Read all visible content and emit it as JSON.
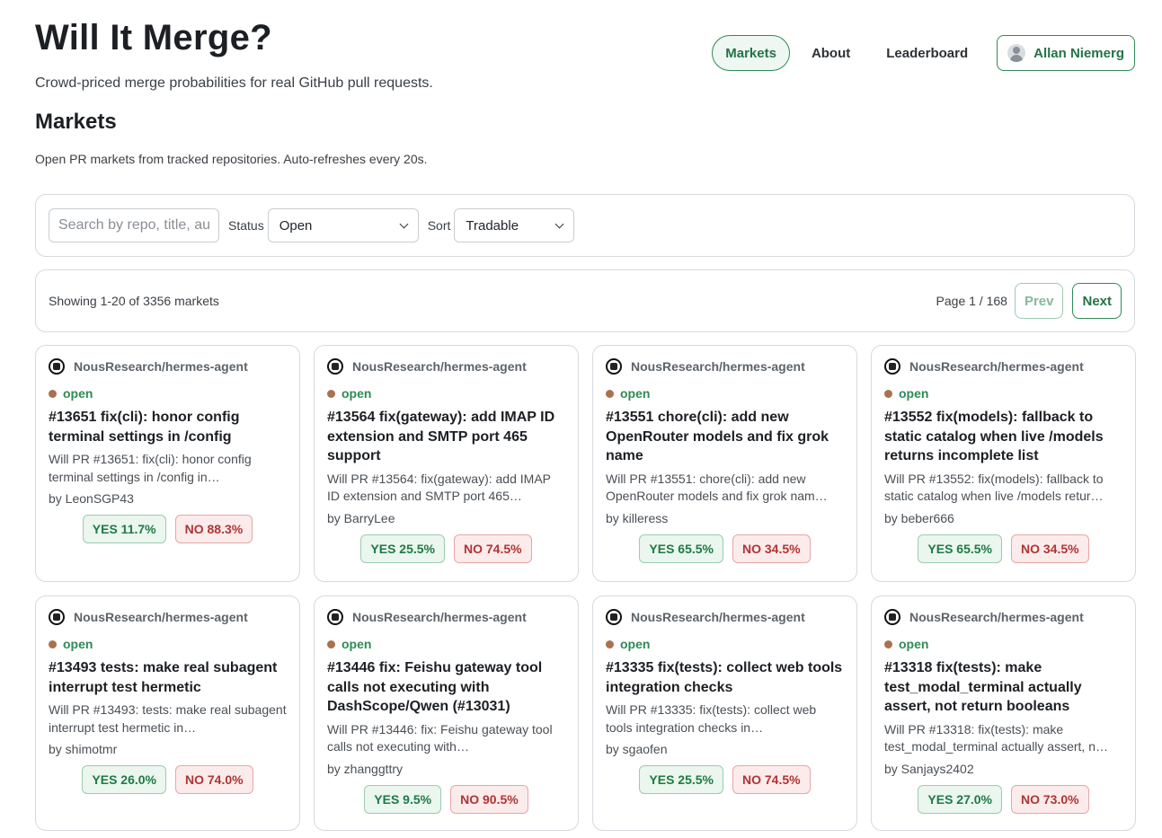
{
  "site": {
    "title": "Will It Merge?",
    "tagline": "Crowd-priced merge probabilities for real GitHub pull requests."
  },
  "nav": {
    "markets": "Markets",
    "about": "About",
    "leaderboard": "Leaderboard",
    "user": "Allan Niemerg"
  },
  "section": {
    "title": "Markets",
    "subtitle": "Open PR markets from tracked repositories. Auto-refreshes every 20s."
  },
  "filters": {
    "search_placeholder": "Search by repo, title, author",
    "status_label": "Status",
    "status_value": "Open",
    "sort_label": "Sort",
    "sort_value": "Tradable"
  },
  "pagination": {
    "showing": "Showing 1-20 of 3356 markets",
    "page": "Page 1 / 168",
    "prev": "Prev",
    "next": "Next"
  },
  "cards": [
    {
      "repo": "NousResearch/hermes-agent",
      "status": "open",
      "title": "#13651 fix(cli): honor config terminal settings in /config",
      "desc": "Will PR #13651: fix(cli): honor config terminal settings in /config in…",
      "author": "by LeonSGP43",
      "yes": "YES 11.7%",
      "no": "NO 88.3%"
    },
    {
      "repo": "NousResearch/hermes-agent",
      "status": "open",
      "title": "#13564 fix(gateway): add IMAP ID extension and SMTP port 465 support",
      "desc": "Will PR #13564: fix(gateway): add IMAP ID extension and SMTP port 465…",
      "author": "by BarryLee",
      "yes": "YES 25.5%",
      "no": "NO 74.5%"
    },
    {
      "repo": "NousResearch/hermes-agent",
      "status": "open",
      "title": "#13551 chore(cli): add new OpenRouter models and fix grok name",
      "desc": "Will PR #13551: chore(cli): add new OpenRouter models and fix grok nam…",
      "author": "by killeress",
      "yes": "YES 65.5%",
      "no": "NO 34.5%"
    },
    {
      "repo": "NousResearch/hermes-agent",
      "status": "open",
      "title": "#13552 fix(models): fallback to static catalog when live /models returns incomplete list",
      "desc": "Will PR #13552: fix(models): fallback to static catalog when live /models retur…",
      "author": "by beber666",
      "yes": "YES 65.5%",
      "no": "NO 34.5%"
    },
    {
      "repo": "NousResearch/hermes-agent",
      "status": "open",
      "title": "#13493 tests: make real subagent interrupt test hermetic",
      "desc": "Will PR #13493: tests: make real subagent interrupt test hermetic in…",
      "author": "by shimotmr",
      "yes": "YES 26.0%",
      "no": "NO 74.0%"
    },
    {
      "repo": "NousResearch/hermes-agent",
      "status": "open",
      "title": "#13446 fix: Feishu gateway tool calls not executing with DashScope/Qwen (#13031)",
      "desc": "Will PR #13446: fix: Feishu gateway tool calls not executing with…",
      "author": "by zhanggttry",
      "yes": "YES 9.5%",
      "no": "NO 90.5%"
    },
    {
      "repo": "NousResearch/hermes-agent",
      "status": "open",
      "title": "#13335 fix(tests): collect web tools integration checks",
      "desc": "Will PR #13335: fix(tests): collect web tools integration checks in…",
      "author": "by sgaofen",
      "yes": "YES 25.5%",
      "no": "NO 74.5%"
    },
    {
      "repo": "NousResearch/hermes-agent",
      "status": "open",
      "title": "#13318 fix(tests): make test_modal_terminal actually assert, not return booleans",
      "desc": "Will PR #13318: fix(tests): make test_modal_terminal actually assert, n…",
      "author": "by Sanjays2402",
      "yes": "YES 27.0%",
      "no": "NO 73.0%"
    }
  ],
  "colors": {
    "accent": "#2f8a57",
    "yes_bg": "#eaf6ee",
    "no_bg": "#fcebeb",
    "status_dot": "#a9714f"
  }
}
